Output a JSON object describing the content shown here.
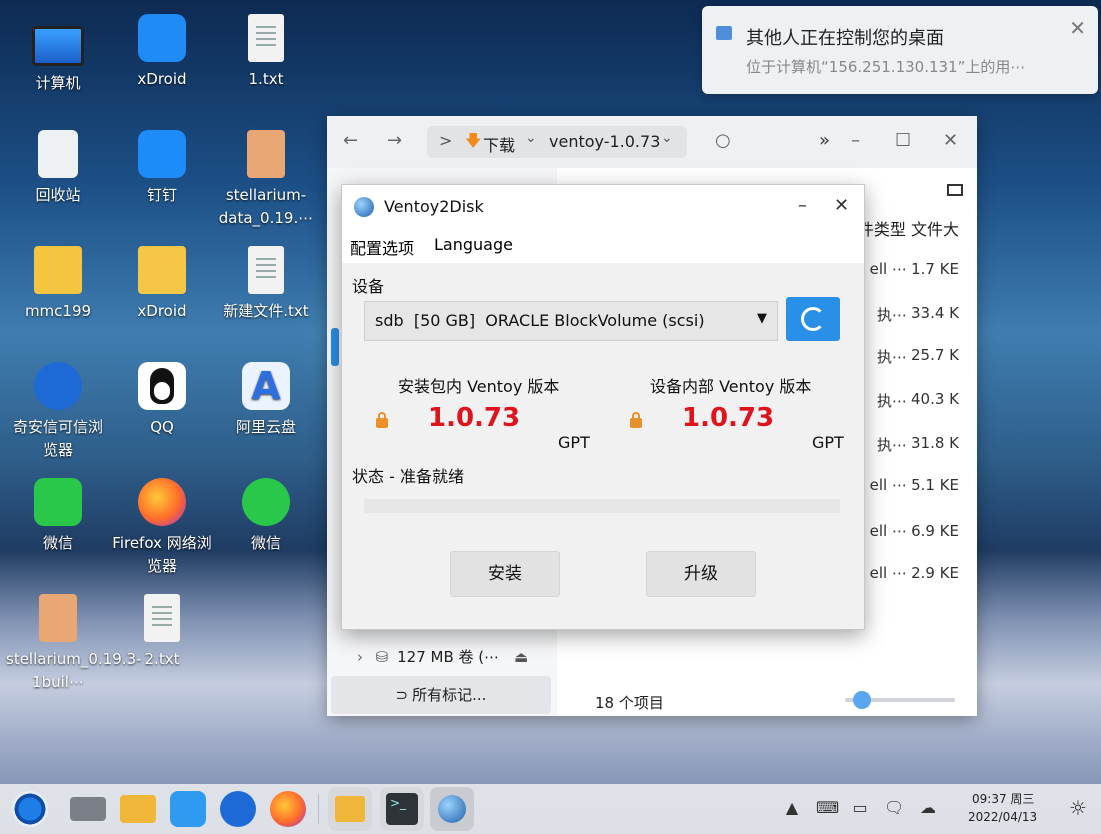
{
  "notification": {
    "title": "其他人正在控制您的桌面",
    "body": "位于计算机“156.251.130.131”上的用⋯",
    "close": "✕"
  },
  "desktop": {
    "icons": [
      {
        "label": "计算机"
      },
      {
        "label": "xDroid"
      },
      {
        "label": "1.txt"
      },
      {
        "label": "回收站"
      },
      {
        "label": "钉钉"
      },
      {
        "label": "stellarium-data_0.19.⋯"
      },
      {
        "label": "mmc199"
      },
      {
        "label": "xDroid"
      },
      {
        "label": "新建文件.txt"
      },
      {
        "label": "奇安信可信浏览器"
      },
      {
        "label": "QQ"
      },
      {
        "label": "阿里云盘"
      },
      {
        "label": "微信"
      },
      {
        "label": "Firefox 网络浏览器"
      },
      {
        "label": "微信"
      },
      {
        "label": "stellarium_0.19.3-1buil⋯"
      },
      {
        "label": "2.txt"
      }
    ]
  },
  "file_manager": {
    "back": "←",
    "forward": "→",
    "breadcrumb_toggle": ">",
    "breadcrumb": [
      "下载",
      "ventoy-1.0.73"
    ],
    "more": "»",
    "search": "○",
    "min": "–",
    "max": "☐",
    "close": "✕",
    "col_headers": "件类型 文件大",
    "rows": [
      {
        "type": "ell ⋯",
        "size": "1.7 KE"
      },
      {
        "type": "执⋯",
        "size": "33.4 K"
      },
      {
        "type": "执⋯",
        "size": "25.7 K"
      },
      {
        "type": "执⋯",
        "size": "40.3 K"
      },
      {
        "type": "执⋯",
        "size": "31.8 K"
      },
      {
        "type": "ell ⋯",
        "size": "5.1 KE"
      },
      {
        "type": "ell ⋯",
        "size": "6.9 KE"
      },
      {
        "type": "ell ⋯",
        "size": "2.9 KE"
      }
    ],
    "sidebar_volume": "127 MB 卷 (⋯",
    "sidebar_tags": "所有标记...",
    "item_count": "18 个项目",
    "zoom_level": 0.15
  },
  "ventoy": {
    "title": "Ventoy2Disk",
    "min": "–",
    "close": "✕",
    "menu": [
      "配置选项",
      "Language"
    ],
    "device_label": "设备",
    "device_value": "sdb  [50 GB]  ORACLE BlockVolume (scsi)",
    "pkg_version_label": "安装包内 Ventoy 版本",
    "dev_version_label": "设备内部 Ventoy 版本",
    "pkg_version": "1.0.73",
    "dev_version": "1.0.73",
    "pkg_part": "GPT",
    "dev_part": "GPT",
    "status": "状态 - 准备就绪",
    "progress": 0,
    "install_label": "安装",
    "upgrade_label": "升级"
  },
  "taskbar": {
    "time": "09:37 周三",
    "date": "2022/04/13"
  }
}
